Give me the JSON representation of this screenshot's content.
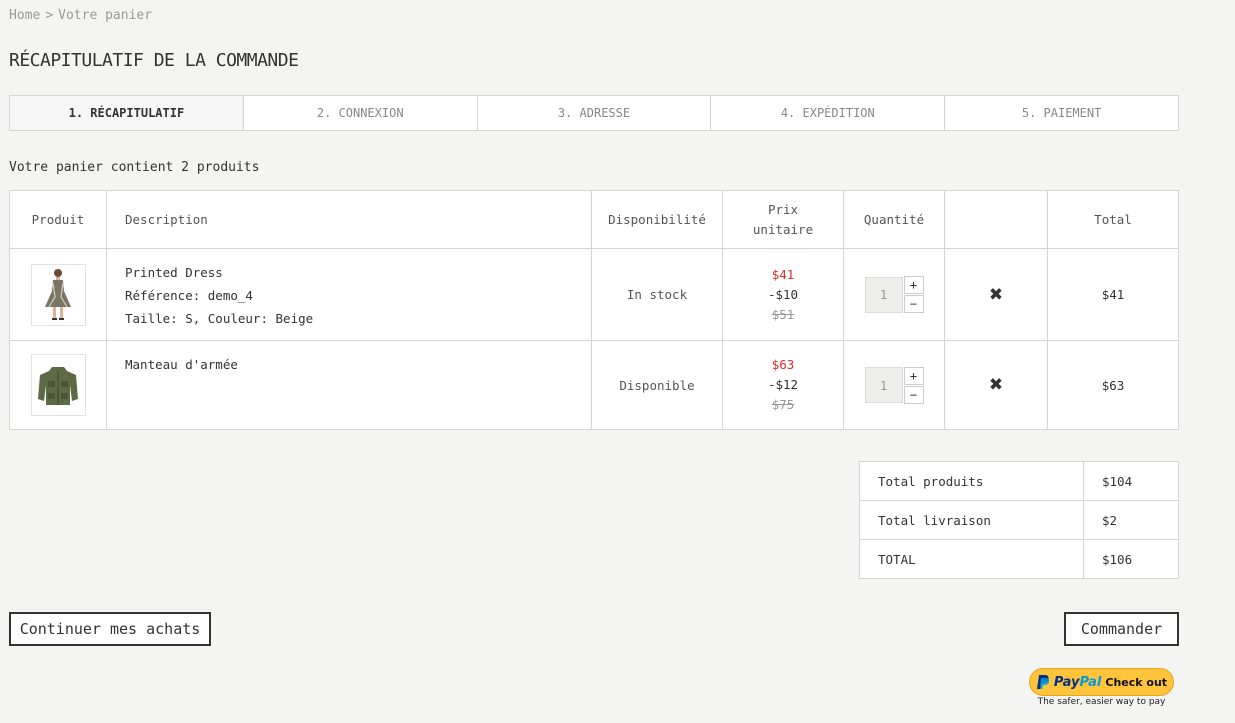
{
  "breadcrumb": {
    "home": "Home",
    "separator": ">",
    "current": "Votre panier"
  },
  "page_title": "RÉCAPITULATIF DE LA COMMANDE",
  "steps": [
    {
      "label": "1. RÉCAPITULATIF",
      "active": true
    },
    {
      "label": "2. CONNEXION",
      "active": false
    },
    {
      "label": "3. ADRESSE",
      "active": false
    },
    {
      "label": "4. EXPÉDITION",
      "active": false
    },
    {
      "label": "5. PAIEMENT",
      "active": false
    }
  ],
  "summary_text": "Votre panier contient 2 produits",
  "table": {
    "headers": {
      "product": "Produit",
      "description": "Description",
      "availability": "Disponibilité",
      "unit_price": "Prix unitaire",
      "quantity": "Quantité",
      "delete": "",
      "total": "Total"
    },
    "rows": [
      {
        "name": "Printed Dress",
        "reference": "Référence: demo_4",
        "attributes": "Taille: S, Couleur: Beige",
        "availability": "In stock",
        "price_new": "$41",
        "discount": "-$10",
        "price_old": "$51",
        "quantity": "1",
        "total": "$41",
        "thumb_icon": "dress-thumbnail"
      },
      {
        "name": "Manteau d'armée",
        "reference": "",
        "attributes": "",
        "availability": "Disponible",
        "price_new": "$63",
        "discount": "-$12",
        "price_old": "$75",
        "quantity": "1",
        "total": "$63",
        "thumb_icon": "jacket-thumbnail"
      }
    ],
    "plus_label": "+",
    "minus_label": "−",
    "delete_icon": "✖"
  },
  "totals": {
    "products_label": "Total produits",
    "products_value": "$104",
    "shipping_label": "Total livraison",
    "shipping_value": "$2",
    "total_label": "TOTAL",
    "total_value": "$106"
  },
  "buttons": {
    "continue": "Continuer mes achats",
    "order": "Commander"
  },
  "paypal": {
    "brand_pay": "Pay",
    "brand_pal": "Pal",
    "checkout": "Check out",
    "tagline": "The safer, easier way to pay"
  },
  "colors": {
    "accent_price": "#e02b27",
    "paypal_yellow": "#ffc439",
    "paypal_blue": "#003087"
  }
}
